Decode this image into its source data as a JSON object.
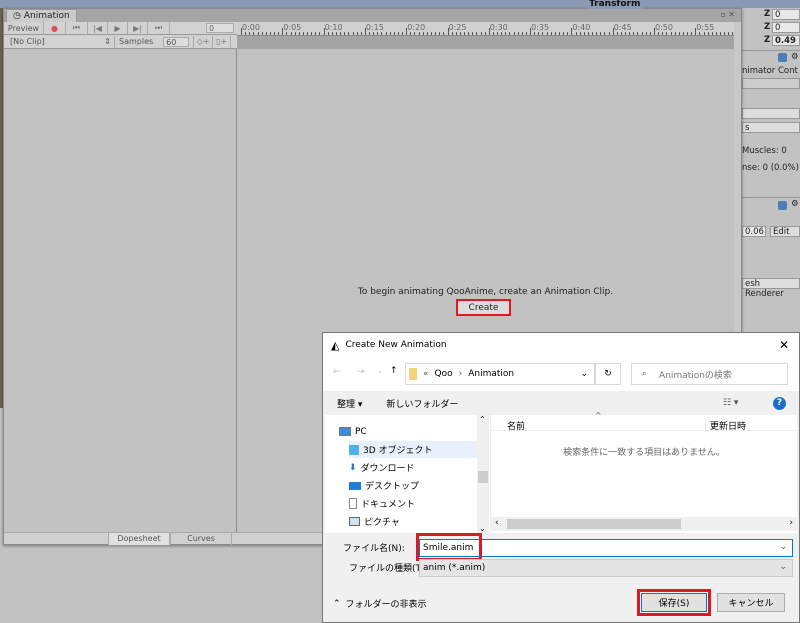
{
  "inspector": {
    "transform_label": "Transform",
    "z_label": "Z",
    "z_values": [
      "0",
      "0",
      "0.49"
    ],
    "animator_label": "nimator Cont",
    "s_label": "s",
    "muscles": "Muscles: 0",
    "sense": "nse: 0 (0.0%)",
    "value_006": "0.06",
    "edit_label": "Edit",
    "mesh_renderer": "esh Renderer"
  },
  "animation_window": {
    "tab_label": "Animation",
    "preview_label": "Preview",
    "frame_value": "0",
    "clip_select": "[No Clip]",
    "samples_label": "Samples",
    "samples_value": "60",
    "ruler_ticks": [
      "0:00",
      "0:05",
      "0:10",
      "0:15",
      "0:20",
      "0:25",
      "0:30",
      "0:35",
      "0:40",
      "0:45",
      "0:50",
      "0:55"
    ],
    "message": "To begin animating QooAnime, create an Animation Clip.",
    "create_label": "Create",
    "bottom_tabs": [
      "Dopesheet",
      "Curves"
    ]
  },
  "dialog": {
    "title": "Create New Animation",
    "breadcrumb": [
      "Qoo",
      "Animation"
    ],
    "breadcrumb_prefix": "«",
    "search_placeholder": "Animationの検索",
    "organize_label": "整理 ▾",
    "new_folder_label": "新しいフォルダー",
    "tree_items": [
      {
        "label": "PC",
        "icon": "pc-icon"
      },
      {
        "label": "3D オブジェクト",
        "icon": "3d-objects-icon"
      },
      {
        "label": "ダウンロード",
        "icon": "download-icon"
      },
      {
        "label": "デスクトップ",
        "icon": "desktop-icon"
      },
      {
        "label": "ドキュメント",
        "icon": "document-icon"
      },
      {
        "label": "ピクチャ",
        "icon": "pictures-icon"
      }
    ],
    "columns": [
      "名前",
      "更新日時"
    ],
    "empty_message": "検索条件に一致する項目はありません。",
    "filename_label": "ファイル名(N):",
    "filename_value": "Smile.anim",
    "filetype_label": "ファイルの種類(T):",
    "filetype_value": "anim (*.anim)",
    "hide_folders_label": "フォルダーの非表示",
    "save_label": "保存(S)",
    "cancel_label": "キャンセル"
  },
  "colors": {
    "highlight": "#e0191e",
    "accent": "#0078d7",
    "unity_gray": "#c2c2c2"
  }
}
